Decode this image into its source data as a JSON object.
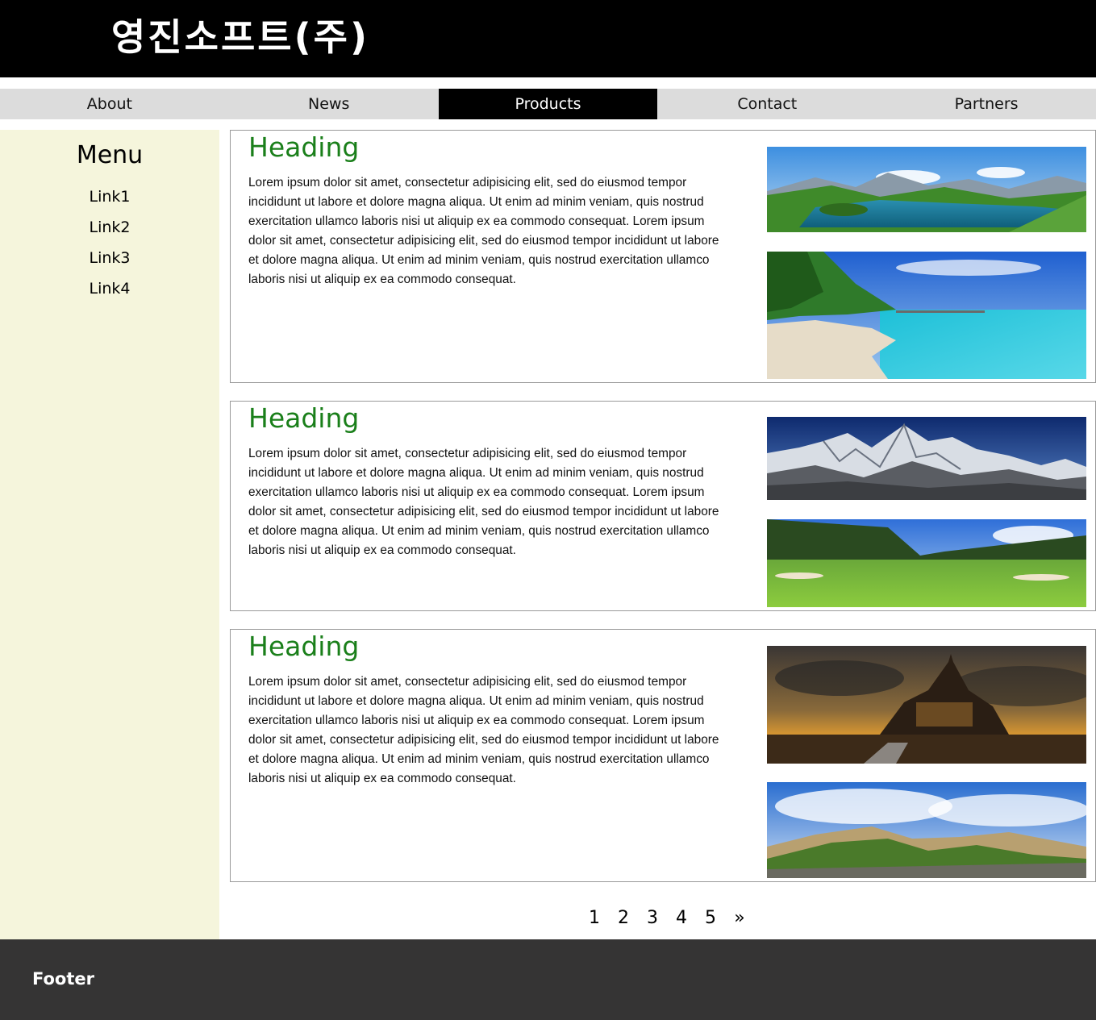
{
  "header": {
    "title": "영진소프트(주)"
  },
  "nav": {
    "items": [
      {
        "label": "About"
      },
      {
        "label": "News"
      },
      {
        "label": "Products"
      },
      {
        "label": "Contact"
      },
      {
        "label": "Partners"
      }
    ],
    "active": "Products"
  },
  "sidebar": {
    "title": "Menu",
    "links": [
      {
        "label": "Link1"
      },
      {
        "label": "Link2"
      },
      {
        "label": "Link3"
      },
      {
        "label": "Link4"
      }
    ]
  },
  "articles": [
    {
      "heading": "Heading",
      "text": "Lorem ipsum dolor sit amet, consectetur adipisicing elit, sed do eiusmod tempor incididunt ut labore et dolore magna aliqua. Ut enim ad minim veniam, quis nostrud exercitation ullamco laboris nisi ut aliquip ex ea commodo consequat. Lorem ipsum dolor sit amet, consectetur adipisicing elit, sed do eiusmod tempor incididunt ut labore et dolore magna aliqua. Ut enim ad minim veniam, quis nostrud exercitation ullamco laboris nisi ut aliquip ex ea commodo consequat.",
      "images": [
        "mountain-lake-image",
        "tropical-beach-image"
      ]
    },
    {
      "heading": "Heading",
      "text": "Lorem ipsum dolor sit amet, consectetur adipisicing elit, sed do eiusmod tempor incididunt ut labore et dolore magna aliqua. Ut enim ad minim veniam, quis nostrud exercitation ullamco laboris nisi ut aliquip ex ea commodo consequat. Lorem ipsum dolor sit amet, consectetur adipisicing elit, sed do eiusmod tempor incididunt ut labore et dolore magna aliqua. Ut enim ad minim veniam, quis nostrud exercitation ullamco laboris nisi ut aliquip ex ea commodo consequat.",
      "images": [
        "snowy-mountains-image",
        "golf-course-image"
      ]
    },
    {
      "heading": "Heading",
      "text": "Lorem ipsum dolor sit amet, consectetur adipisicing elit, sed do eiusmod tempor incididunt ut labore et dolore magna aliqua. Ut enim ad minim veniam, quis nostrud exercitation ullamco laboris nisi ut aliquip ex ea commodo consequat. Lorem ipsum dolor sit amet, consectetur adipisicing elit, sed do eiusmod tempor incididunt ut labore et dolore magna aliqua. Ut enim ad minim veniam, quis nostrud exercitation ullamco laboris nisi ut aliquip ex ea commodo consequat.",
      "images": [
        "castle-sunset-image",
        "green-hills-image"
      ]
    }
  ],
  "pagination": {
    "pages": [
      "1",
      "2",
      "3",
      "4",
      "5",
      "»"
    ]
  },
  "footer": {
    "text": "Footer"
  },
  "colors": {
    "header_bg": "#000000",
    "nav_bg": "#dcdcdc",
    "nav_active_bg": "#000000",
    "sidebar_bg": "#f5f5dc",
    "heading": "#1a7f1a",
    "footer_bg": "#353434"
  }
}
